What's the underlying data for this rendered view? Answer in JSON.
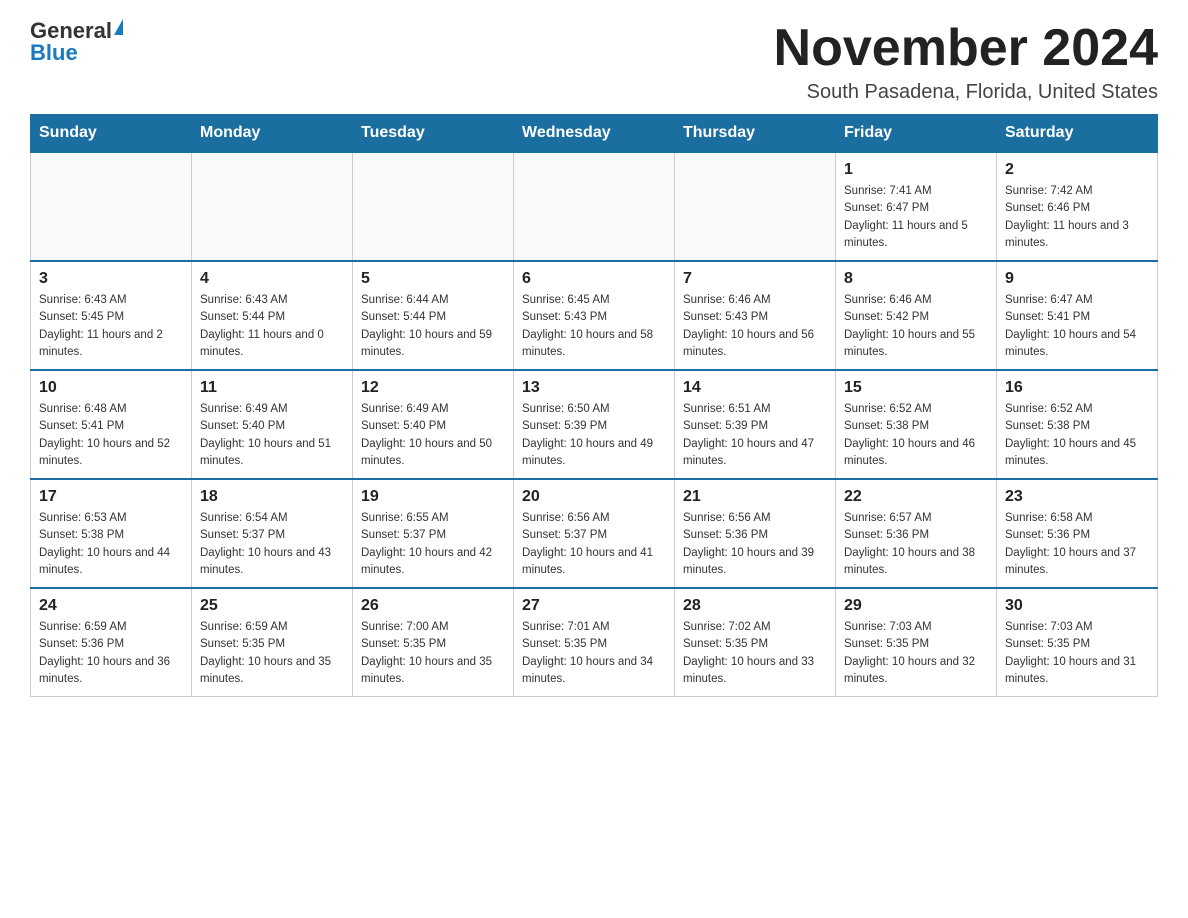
{
  "logo": {
    "general": "General",
    "blue": "Blue"
  },
  "header": {
    "title": "November 2024",
    "subtitle": "South Pasadena, Florida, United States"
  },
  "days_of_week": [
    "Sunday",
    "Monday",
    "Tuesday",
    "Wednesday",
    "Thursday",
    "Friday",
    "Saturday"
  ],
  "weeks": [
    [
      {
        "day": "",
        "info": ""
      },
      {
        "day": "",
        "info": ""
      },
      {
        "day": "",
        "info": ""
      },
      {
        "day": "",
        "info": ""
      },
      {
        "day": "",
        "info": ""
      },
      {
        "day": "1",
        "info": "Sunrise: 7:41 AM\nSunset: 6:47 PM\nDaylight: 11 hours and 5 minutes."
      },
      {
        "day": "2",
        "info": "Sunrise: 7:42 AM\nSunset: 6:46 PM\nDaylight: 11 hours and 3 minutes."
      }
    ],
    [
      {
        "day": "3",
        "info": "Sunrise: 6:43 AM\nSunset: 5:45 PM\nDaylight: 11 hours and 2 minutes."
      },
      {
        "day": "4",
        "info": "Sunrise: 6:43 AM\nSunset: 5:44 PM\nDaylight: 11 hours and 0 minutes."
      },
      {
        "day": "5",
        "info": "Sunrise: 6:44 AM\nSunset: 5:44 PM\nDaylight: 10 hours and 59 minutes."
      },
      {
        "day": "6",
        "info": "Sunrise: 6:45 AM\nSunset: 5:43 PM\nDaylight: 10 hours and 58 minutes."
      },
      {
        "day": "7",
        "info": "Sunrise: 6:46 AM\nSunset: 5:43 PM\nDaylight: 10 hours and 56 minutes."
      },
      {
        "day": "8",
        "info": "Sunrise: 6:46 AM\nSunset: 5:42 PM\nDaylight: 10 hours and 55 minutes."
      },
      {
        "day": "9",
        "info": "Sunrise: 6:47 AM\nSunset: 5:41 PM\nDaylight: 10 hours and 54 minutes."
      }
    ],
    [
      {
        "day": "10",
        "info": "Sunrise: 6:48 AM\nSunset: 5:41 PM\nDaylight: 10 hours and 52 minutes."
      },
      {
        "day": "11",
        "info": "Sunrise: 6:49 AM\nSunset: 5:40 PM\nDaylight: 10 hours and 51 minutes."
      },
      {
        "day": "12",
        "info": "Sunrise: 6:49 AM\nSunset: 5:40 PM\nDaylight: 10 hours and 50 minutes."
      },
      {
        "day": "13",
        "info": "Sunrise: 6:50 AM\nSunset: 5:39 PM\nDaylight: 10 hours and 49 minutes."
      },
      {
        "day": "14",
        "info": "Sunrise: 6:51 AM\nSunset: 5:39 PM\nDaylight: 10 hours and 47 minutes."
      },
      {
        "day": "15",
        "info": "Sunrise: 6:52 AM\nSunset: 5:38 PM\nDaylight: 10 hours and 46 minutes."
      },
      {
        "day": "16",
        "info": "Sunrise: 6:52 AM\nSunset: 5:38 PM\nDaylight: 10 hours and 45 minutes."
      }
    ],
    [
      {
        "day": "17",
        "info": "Sunrise: 6:53 AM\nSunset: 5:38 PM\nDaylight: 10 hours and 44 minutes."
      },
      {
        "day": "18",
        "info": "Sunrise: 6:54 AM\nSunset: 5:37 PM\nDaylight: 10 hours and 43 minutes."
      },
      {
        "day": "19",
        "info": "Sunrise: 6:55 AM\nSunset: 5:37 PM\nDaylight: 10 hours and 42 minutes."
      },
      {
        "day": "20",
        "info": "Sunrise: 6:56 AM\nSunset: 5:37 PM\nDaylight: 10 hours and 41 minutes."
      },
      {
        "day": "21",
        "info": "Sunrise: 6:56 AM\nSunset: 5:36 PM\nDaylight: 10 hours and 39 minutes."
      },
      {
        "day": "22",
        "info": "Sunrise: 6:57 AM\nSunset: 5:36 PM\nDaylight: 10 hours and 38 minutes."
      },
      {
        "day": "23",
        "info": "Sunrise: 6:58 AM\nSunset: 5:36 PM\nDaylight: 10 hours and 37 minutes."
      }
    ],
    [
      {
        "day": "24",
        "info": "Sunrise: 6:59 AM\nSunset: 5:36 PM\nDaylight: 10 hours and 36 minutes."
      },
      {
        "day": "25",
        "info": "Sunrise: 6:59 AM\nSunset: 5:35 PM\nDaylight: 10 hours and 35 minutes."
      },
      {
        "day": "26",
        "info": "Sunrise: 7:00 AM\nSunset: 5:35 PM\nDaylight: 10 hours and 35 minutes."
      },
      {
        "day": "27",
        "info": "Sunrise: 7:01 AM\nSunset: 5:35 PM\nDaylight: 10 hours and 34 minutes."
      },
      {
        "day": "28",
        "info": "Sunrise: 7:02 AM\nSunset: 5:35 PM\nDaylight: 10 hours and 33 minutes."
      },
      {
        "day": "29",
        "info": "Sunrise: 7:03 AM\nSunset: 5:35 PM\nDaylight: 10 hours and 32 minutes."
      },
      {
        "day": "30",
        "info": "Sunrise: 7:03 AM\nSunset: 5:35 PM\nDaylight: 10 hours and 31 minutes."
      }
    ]
  ]
}
